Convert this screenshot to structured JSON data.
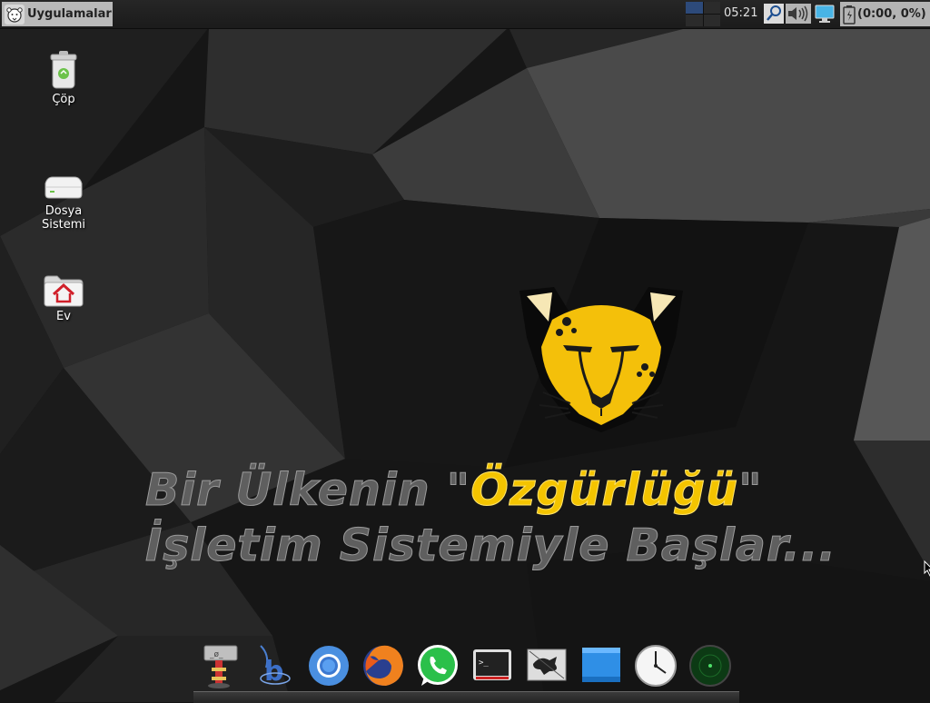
{
  "top_panel": {
    "apps_menu_label": "Uygulamalar",
    "clock": "05:21",
    "battery_text": "(0:00, 0%)",
    "workspaces": [
      true,
      false,
      false,
      false
    ]
  },
  "desktop_icons": [
    {
      "label": "Çöp",
      "icon": "trash-icon"
    },
    {
      "label": "Dosya Sistemi",
      "icon": "drive-icon"
    },
    {
      "label": "Ev",
      "icon": "home-folder-icon"
    }
  ],
  "slogan": {
    "line1_prefix": "Bir Ülkenin \"",
    "line1_highlight": "Özgürlüğü",
    "line1_suffix": "\"",
    "line2": "İşletim Sistemiyle Başlar..."
  },
  "dock_items": [
    "app-installer-icon",
    "bleachbit-icon",
    "chromium-icon",
    "firefox-icon",
    "whatsapp-icon",
    "terminal-icon",
    "xfce-settings-icon",
    "file-manager-icon",
    "clock-icon",
    "radar-icon"
  ],
  "colors": {
    "accent_yellow": "#f4c400",
    "slogan_gray": "#5f5f5f",
    "panel_bg": "#1f1f1f"
  }
}
